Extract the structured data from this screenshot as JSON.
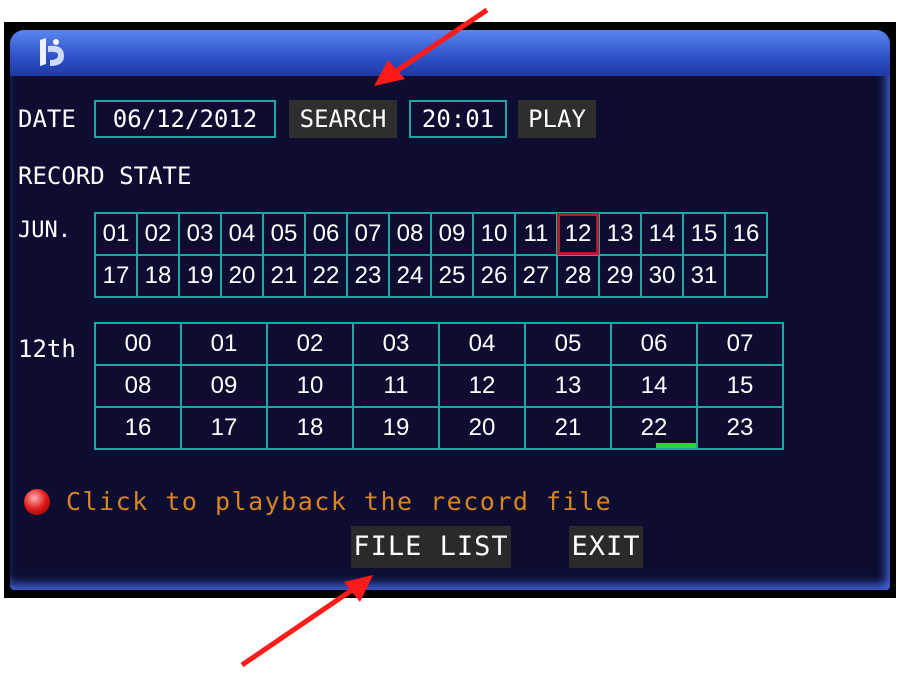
{
  "date_row": {
    "date_label": "DATE",
    "date_value": "06/12/2012",
    "search_label": "SEARCH",
    "time_value": "20:01",
    "play_label": "PLAY"
  },
  "record_state_label": "RECORD STATE",
  "month": {
    "label": "JUN.",
    "days_row1": [
      "01",
      "02",
      "03",
      "04",
      "05",
      "06",
      "07",
      "08",
      "09",
      "10",
      "11",
      "12",
      "13",
      "14",
      "15",
      "16"
    ],
    "days_row2": [
      "17",
      "18",
      "19",
      "20",
      "21",
      "22",
      "23",
      "24",
      "25",
      "26",
      "27",
      "28",
      "29",
      "30",
      "31",
      ""
    ],
    "selected_day": "12"
  },
  "day": {
    "label": "12th",
    "hours": [
      [
        "00",
        "01",
        "02",
        "03",
        "04",
        "05",
        "06",
        "07"
      ],
      [
        "08",
        "09",
        "10",
        "11",
        "12",
        "13",
        "14",
        "15"
      ],
      [
        "16",
        "17",
        "18",
        "19",
        "20",
        "21",
        "22",
        "23"
      ]
    ],
    "recorded_hour": "22"
  },
  "hint": {
    "text": "Click to playback the record file",
    "icon": "red-dot-icon"
  },
  "buttons": {
    "file_list": "FILE LIST",
    "exit": "EXIT"
  },
  "colors": {
    "panel_bg": "#0c0d30",
    "grid_border": "#1fa7a2",
    "selected_border": "#b21e2a",
    "hint_text": "#d9841e",
    "record_bar": "#18e03a",
    "annotation_arrow": "#ff1a1a"
  }
}
